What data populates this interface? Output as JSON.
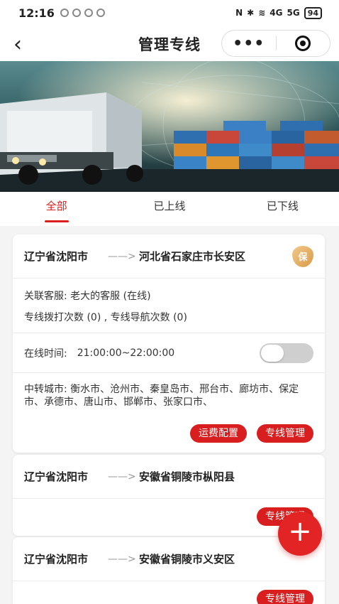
{
  "status_bar": {
    "time": "12:16",
    "net_a": "N",
    "net_b": "4G",
    "net_c": "5G",
    "battery": "94"
  },
  "nav": {
    "back_icon": "‹",
    "title": "管理专线",
    "more_icon": "•••"
  },
  "tabs": [
    {
      "label": "全部"
    },
    {
      "label": "已上线"
    },
    {
      "label": "已下线"
    }
  ],
  "cards": [
    {
      "from": "辽宁省沈阳市",
      "arrow": "——>",
      "to": "河北省石家庄市长安区",
      "badge": "保",
      "service_label": "关联客服:",
      "service_value": "老大的客服 (在线)",
      "stats": "专线拨打次数 (0) , 专线导航次数 (0)",
      "online_label": "在线时间:",
      "online_value": "21:00:00~22:00:00",
      "transfer_label": "中转城市:",
      "transfer_value": "衡水市、沧州市、秦皇岛市、邢台市、廊坊市、保定市、承德市、唐山市、邯郸市、张家口市、",
      "btn_freight": "运费配置",
      "btn_manage": "专线管理"
    },
    {
      "from": "辽宁省沈阳市",
      "arrow": "——>",
      "to": "安徽省铜陵市枞阳县",
      "btn_manage": "专线管理"
    },
    {
      "from": "辽宁省沈阳市",
      "arrow": "——>",
      "to": "安徽省铜陵市义安区",
      "btn_manage": "专线管理"
    }
  ],
  "fab": {
    "icon": "+"
  },
  "colors": {
    "accent": "#d81e1e"
  }
}
